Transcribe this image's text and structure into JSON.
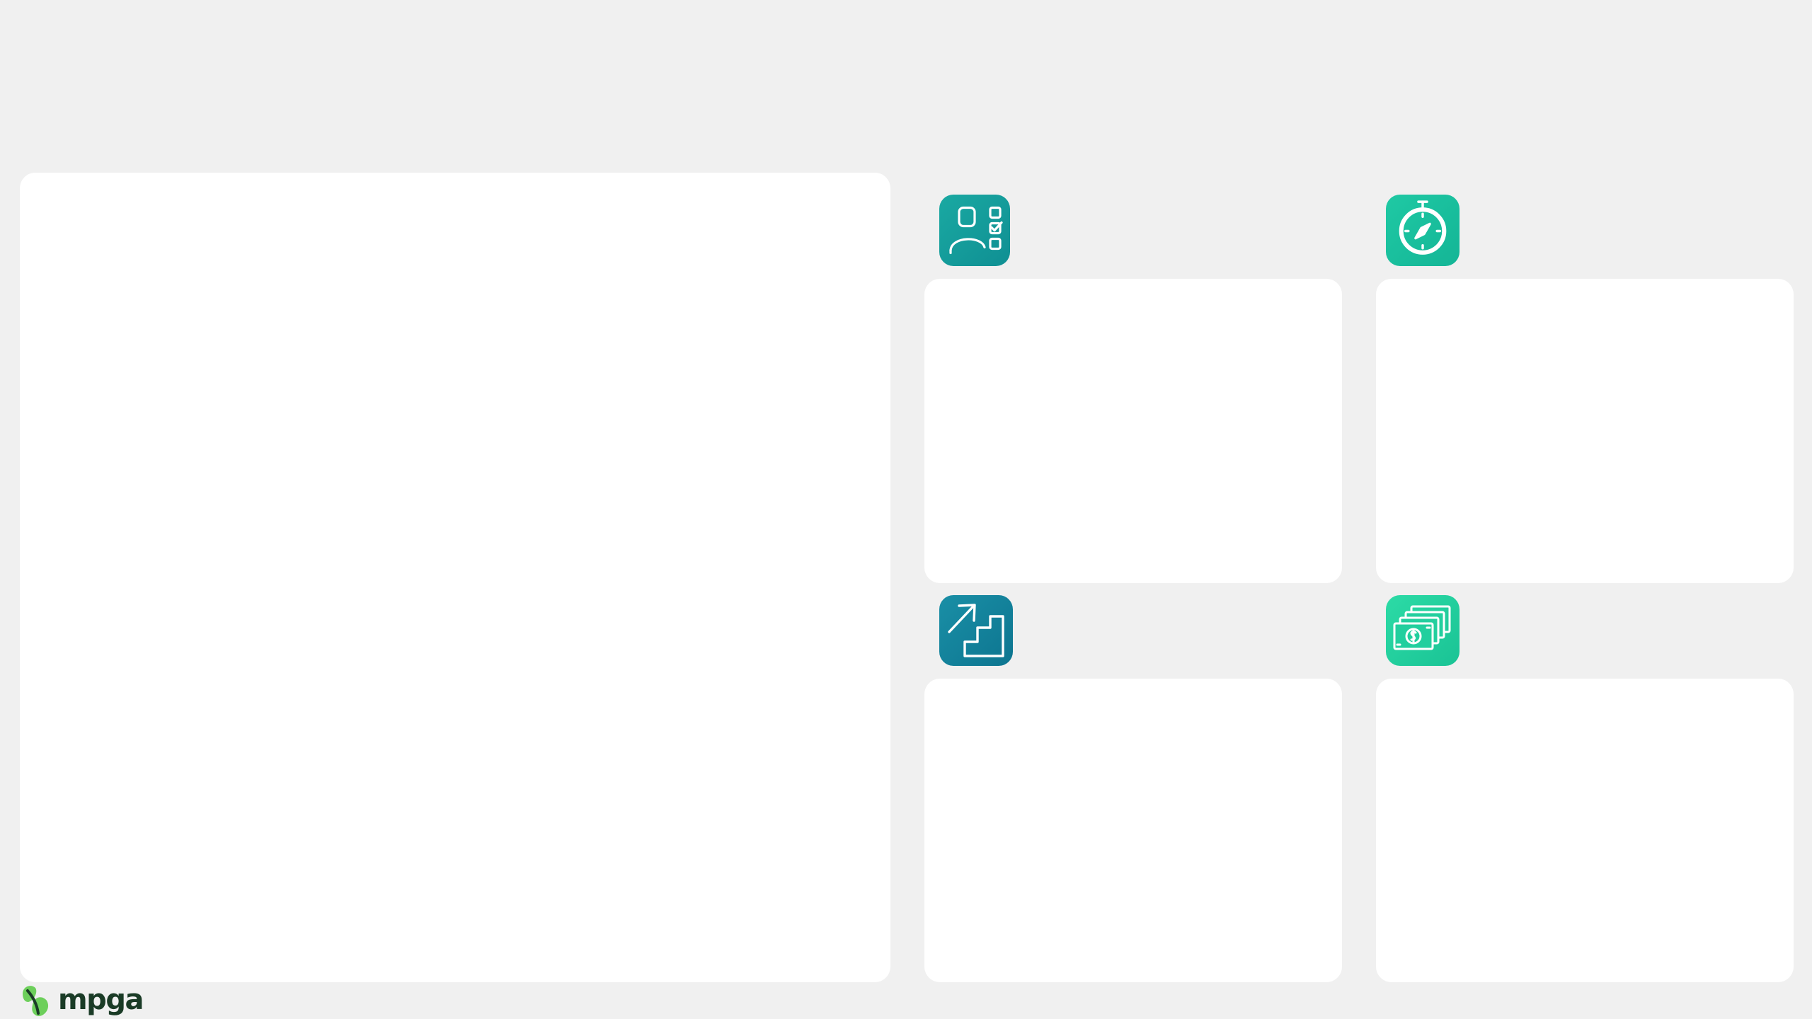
{
  "brand": {
    "name": "mpga",
    "logo_icon": "leaf-logo-icon",
    "text_color": "#1a3b26",
    "leaf_color": "#6dcf5b"
  },
  "page": {
    "background": "#f0f0f0",
    "panel_color": "#ffffff"
  },
  "features": [
    {
      "icon": "person-checklist-icon",
      "accent": "#1aa9a2"
    },
    {
      "icon": "stopwatch-compass-icon",
      "accent": "#1fc9a4"
    },
    {
      "icon": "stairs-growth-arrow-icon",
      "accent": "#1a8fa6"
    },
    {
      "icon": "stacked-banknotes-icon",
      "accent": "#2cdba6"
    }
  ]
}
